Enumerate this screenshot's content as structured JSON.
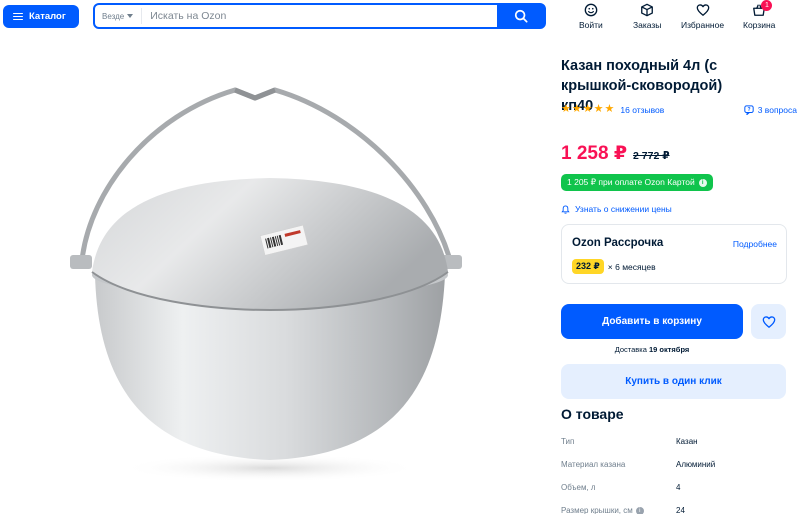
{
  "header": {
    "catalog_label": "Каталог",
    "search_scope": "Везде",
    "search_placeholder": "Искать на Ozon",
    "nav": {
      "login": "Войти",
      "orders": "Заказы",
      "favorites": "Избранное",
      "cart": "Корзина",
      "cart_count": "1"
    }
  },
  "product": {
    "title": "Казан походный 4л (с крышкой-сковородой) кп40",
    "rating_stars": 5,
    "reviews": "16 отзывов",
    "questions": "3 вопроса",
    "price": "1 258 ₽",
    "old_price": "2 772 ₽",
    "card_price": "1 205 ₽ при оплате Ozon Картой",
    "price_alert": "Узнать о снижении цены",
    "installment": {
      "title": "Ozon Рассрочка",
      "more": "Подробнее",
      "amount": "232 ₽",
      "term": "× 6 месяцев"
    },
    "add_to_cart": "Добавить в корзину",
    "delivery_prefix": "Доставка",
    "delivery_date": "19 октября",
    "buy_one_click": "Купить в один клик"
  },
  "about": {
    "title": "О товаре",
    "specs": [
      {
        "key": "Тип",
        "value": "Казан"
      },
      {
        "key": "Материал казана",
        "value": "Алюминий"
      },
      {
        "key": "Объем, л",
        "value": "4"
      },
      {
        "key": "Размер крышки, см",
        "value": "24"
      }
    ]
  },
  "colors": {
    "brand": "#005bff",
    "price": "#f91155",
    "card_green": "#10c44c",
    "star": "#ffa800"
  }
}
